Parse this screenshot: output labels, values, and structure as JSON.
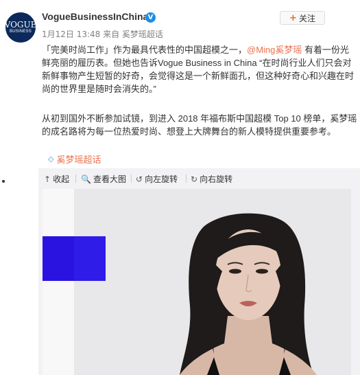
{
  "post": {
    "avatar_text_top": "VOGUE",
    "avatar_text_bottom": "BUSINESS",
    "username": "VogueBusinessInChina",
    "verified_glyph": "V",
    "follow_plus": "+",
    "follow_label": "关注",
    "meta": "1月12日 13:48 来自 奚梦瑶超话",
    "para1_a": "「完美时尚工作」作为最具代表性的中国超模之一，",
    "para1_mention": "@Ming奚梦瑶",
    "para1_b": " 有着一份光鲜亮丽的履历表。但她也告诉Vogue Business in China “在时尚行业人们只会对新鲜事物产生短暂的好奇，会觉得这是一个新鲜面孔，但这种好奇心和兴趣在时尚的世界里是随时会消失的。”",
    "para2": "从初到国外不断参加试镜，到进入 2018 年福布斯中国超模 Top 10 榜单，奚梦瑶的成名路将为每一位热爱时尚、想登上大牌舞台的新人模特提供重要参考。",
    "topic_icon": "◇",
    "topic_label": "奚梦瑶超话"
  },
  "toolbar": {
    "collapse_icon": "↑",
    "collapse_label": "收起",
    "view_icon": "🔍",
    "view_label": "查看大图",
    "rotate_left_icon": "↺",
    "rotate_left_label": "向左旋转",
    "rotate_right_icon": "↻",
    "rotate_right_label": "向右旋转"
  },
  "icons": {
    "avatar": "vogue-business-logo",
    "verified": "verified-badge-icon",
    "topic": "topic-diamond-icon",
    "collapse": "collapse-arrow-icon",
    "view": "magnifier-icon",
    "rotate_left": "rotate-left-icon",
    "rotate_right": "rotate-right-icon"
  },
  "colors": {
    "link": "#eb7350",
    "verified": "#1e8de6",
    "photo_block": "#2a13e0"
  }
}
